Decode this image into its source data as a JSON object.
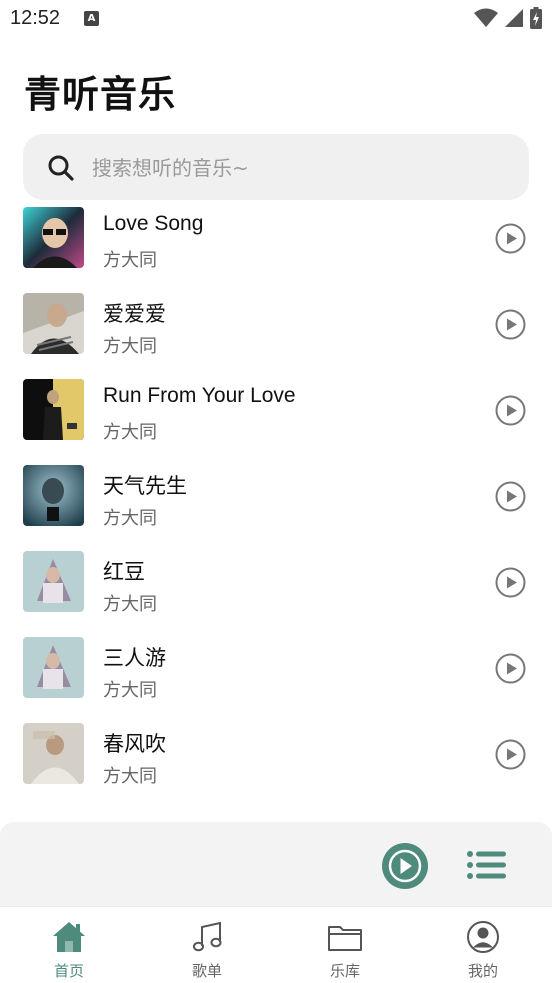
{
  "status": {
    "time": "12:52",
    "badge": "A"
  },
  "header": {
    "title": "青听音乐"
  },
  "search": {
    "placeholder": "搜索想听的音乐~"
  },
  "songs": [
    {
      "title": "Love Song",
      "artist": "方大同"
    },
    {
      "title": "爱爱爱",
      "artist": "方大同"
    },
    {
      "title": "Run From Your Love",
      "artist": "方大同"
    },
    {
      "title": "天气先生",
      "artist": "方大同"
    },
    {
      "title": "红豆",
      "artist": "方大同"
    },
    {
      "title": "三人游",
      "artist": "方大同"
    },
    {
      "title": "春风吹",
      "artist": "方大同"
    }
  ],
  "nav": [
    {
      "label": "首页",
      "icon": "home-icon",
      "active": true
    },
    {
      "label": "歌单",
      "icon": "music-note-icon",
      "active": false
    },
    {
      "label": "乐库",
      "icon": "folder-icon",
      "active": false
    },
    {
      "label": "我的",
      "icon": "user-icon",
      "active": false
    }
  ],
  "colors": {
    "accent": "#4e8b7d",
    "search_bg": "#f0f0f0",
    "player_bg": "#f3f3f3"
  }
}
